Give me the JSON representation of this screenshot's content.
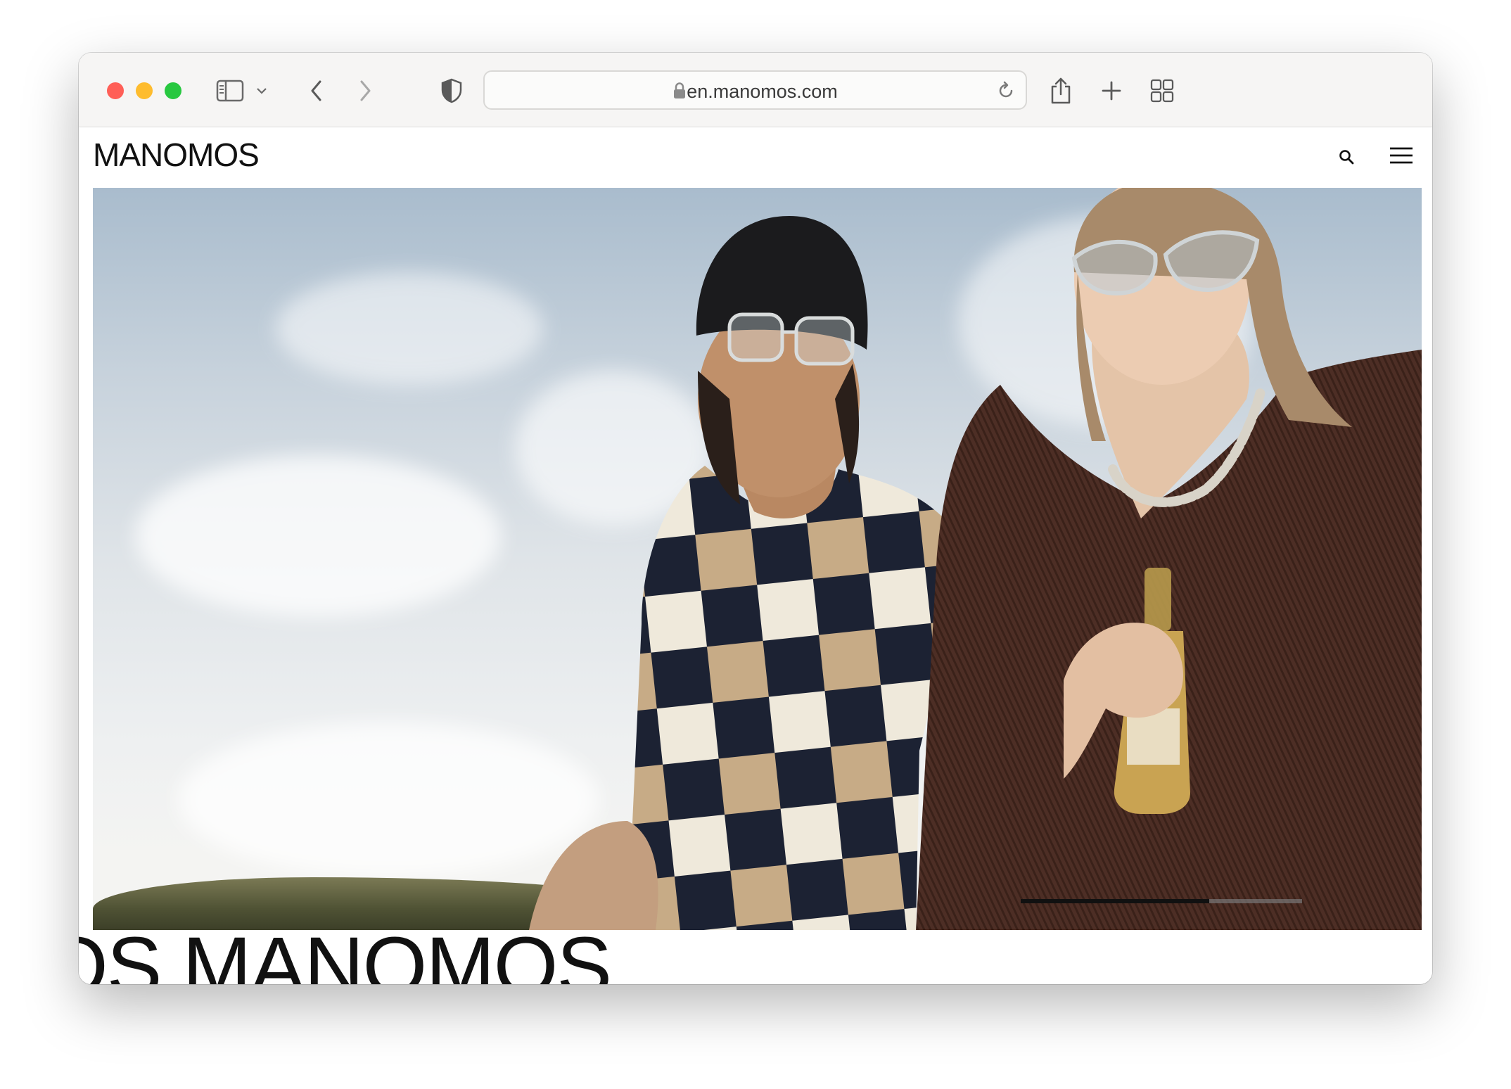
{
  "browser": {
    "address_url": "en.manomos.com",
    "traffic_lights": {
      "close": "#ff5f57",
      "minimize": "#febc2e",
      "zoom": "#28c840"
    },
    "icons": [
      "sidebar-icon",
      "chevron-down-icon",
      "back-icon",
      "forward-icon",
      "shield-icon",
      "lock-icon",
      "reload-icon",
      "share-icon",
      "new-tab-icon",
      "tab-overview-icon"
    ]
  },
  "site": {
    "logo": "MANOMOS",
    "header_icons": [
      "search-icon",
      "hamburger-menu-icon"
    ],
    "marquee_text": "OS MANOMOS",
    "hero": {
      "slide_progress": 0.67
    }
  }
}
